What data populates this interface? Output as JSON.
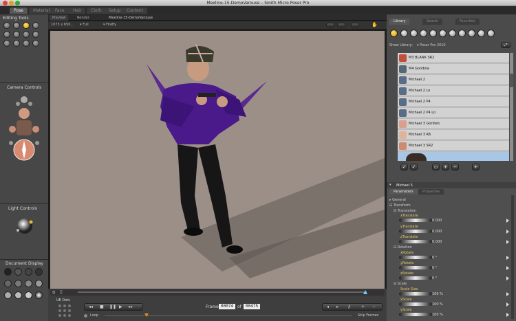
{
  "window": {
    "title": "Mexline-15-DemoVarouse – Smith Micro Poser Pro"
  },
  "rooms": [
    {
      "label": "Pose",
      "active": true
    },
    {
      "label": "Material",
      "active": false
    },
    {
      "label": "Face",
      "active": false
    },
    {
      "label": "Hair",
      "active": false
    },
    {
      "label": "Cloth",
      "active": false
    },
    {
      "label": "Setup",
      "active": false
    },
    {
      "label": "Content",
      "active": false
    }
  ],
  "left": {
    "editing_tools": "Editing Tools",
    "camera_controls": "Camera Controls",
    "light_controls": "Light Controls",
    "document_display": "Document Display",
    "ue_dots": "UE Dots"
  },
  "viewport": {
    "tabs": [
      "Preview",
      "Render"
    ],
    "doc_tab": "Mexline-15-DemoVarouse",
    "size": "1073 x 650...",
    "dropdown_1": "Full",
    "dropdown_2": "Firefly"
  },
  "timeline": {
    "frame_label": "Frame",
    "frame": "00074",
    "of_label": "of",
    "total": "00475",
    "loop": "Loop",
    "skip": "Skip Frames"
  },
  "library": {
    "tabs": [
      "Library",
      "Search",
      "Favorites"
    ],
    "show_library_label": "Show Library:",
    "show_library_value": "Poser Pro 2010",
    "items": [
      {
        "label": "M3 BLANK SR2",
        "thumb_color": "#c0503a"
      },
      {
        "label": "M4 Gondola",
        "thumb_color": "#556677"
      },
      {
        "label": "Michael 2",
        "thumb_color": "#5a6d86"
      },
      {
        "label": "Michael 2 Lo",
        "thumb_color": "#5a6d86"
      },
      {
        "label": "Michael 2 P4",
        "thumb_color": "#5a6d86"
      },
      {
        "label": "Michael 2 P4 Lo",
        "thumb_color": "#5a6d86"
      },
      {
        "label": "Michael 3 Gorilleb",
        "thumb_color": "#d9a08d"
      },
      {
        "label": "Michael 3 R6",
        "thumb_color": "#e0b49a"
      },
      {
        "label": "Michael 3 SR2",
        "thumb_color": "#d08a70"
      }
    ]
  },
  "params": {
    "figure": "Michael 5",
    "tabs": [
      "Parameters",
      "Properties"
    ],
    "general": "General",
    "transform": "Transform",
    "translation": "Translation",
    "rotation": "Rotation",
    "scale": "Scale",
    "rows": [
      {
        "label": "xTranslate",
        "value": "0.000"
      },
      {
        "label": "yTranslate",
        "value": "0.000"
      },
      {
        "label": "zTranslate",
        "value": "0.000"
      },
      {
        "label": "xRotate",
        "value": "0 °"
      },
      {
        "label": "yRotate",
        "value": "0 °"
      },
      {
        "label": "zRotate",
        "value": "0 °"
      },
      {
        "label": "Scale Size",
        "value": "100 %"
      },
      {
        "label": "xScale",
        "value": "100 %"
      },
      {
        "label": "yScale",
        "value": "100 %"
      }
    ]
  }
}
